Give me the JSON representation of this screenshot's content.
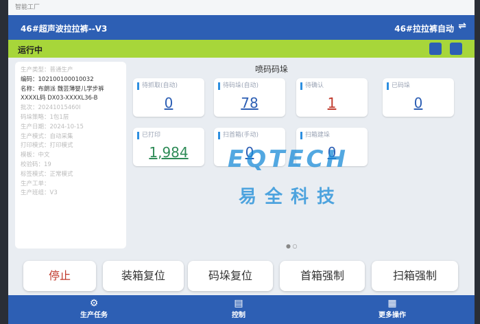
{
  "window": {
    "title": "智能工厂"
  },
  "header": {
    "left": "46#超声波拉拉裤--V3",
    "right": "46#拉拉裤自动",
    "swap_icon": "⇌"
  },
  "status": {
    "text": "运行中"
  },
  "info": [
    "生产类型：普通生产",
    "编码：102100100010032",
    "名称：布朗派 魏芸薄婴儿学步裤",
    "XXXXL码 DX03-XXXXL36-B",
    "批次：20241015460I",
    "码垛策略：1包1层",
    "生产日期：2024-10-15",
    "生产模式：自动采集",
    "打印模式：打印模式",
    "模板：中文",
    "校验码：19",
    "标签模式：正常模式",
    "生产工单：",
    "生产班组：V3"
  ],
  "panel": {
    "title": "喷码码垛"
  },
  "cards": [
    {
      "label": "待抓取(自动)",
      "value": "0",
      "color": "blue"
    },
    {
      "label": "待码垛(自动)",
      "value": "78",
      "color": "blue"
    },
    {
      "label": "待确认",
      "value": "1",
      "color": "red"
    },
    {
      "label": "已码垛",
      "value": "0",
      "color": "blue"
    },
    {
      "label": "已打印",
      "value": "1,984",
      "color": "green"
    },
    {
      "label": "扫首箱(手动)",
      "value": "0",
      "color": "blue"
    },
    {
      "label": "扫箱建垛",
      "value": "0",
      "color": "blue"
    }
  ],
  "watermark": {
    "en": "EQTECH",
    "cn": "易全科技"
  },
  "buttons": [
    "停止",
    "装箱复位",
    "码垛复位",
    "首箱强制",
    "扫箱强制"
  ],
  "tabs": [
    {
      "label": "生产任务",
      "icon": "⚙"
    },
    {
      "label": "控制",
      "icon": "▤"
    },
    {
      "label": "更多操作",
      "icon": "▦"
    }
  ]
}
